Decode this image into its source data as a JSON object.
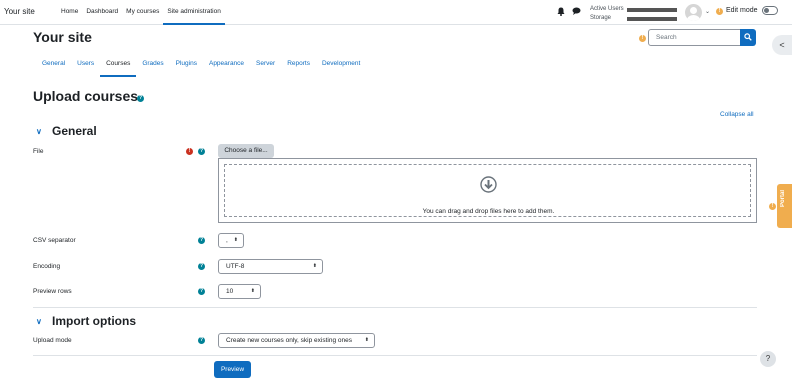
{
  "navbar": {
    "site_name": "Your site",
    "items": [
      "Home",
      "Dashboard",
      "My courses",
      "Site administration"
    ],
    "active_users_label": "Active Users",
    "storage_label": "Storage",
    "edit_mode_label": "Edit mode",
    "warning_glyph": "!"
  },
  "header": {
    "title": "Your site",
    "search_placeholder": "Search"
  },
  "secondary_nav": [
    "General",
    "Users",
    "Courses",
    "Grades",
    "Plugins",
    "Appearance",
    "Server",
    "Reports",
    "Development"
  ],
  "page": {
    "heading": "Upload courses",
    "collapse_all": "Collapse all",
    "help_glyph": "?",
    "required_glyph": "!"
  },
  "general_section": {
    "title": "General",
    "file_label": "File",
    "choose_file_button": "Choose a file...",
    "dropzone_text": "You can drag and drop files here to add them.",
    "csv_separator_label": "CSV separator",
    "csv_separator_value": ",",
    "encoding_label": "Encoding",
    "encoding_value": "UTF-8",
    "preview_rows_label": "Preview rows",
    "preview_rows_value": "10"
  },
  "import_section": {
    "title": "Import options",
    "upload_mode_label": "Upload mode",
    "upload_mode_value": "Create new courses only, skip existing ones"
  },
  "actions": {
    "preview_button": "Preview"
  },
  "floating": {
    "help_button": "?",
    "drawer_toggle": "<",
    "portal_tab": "Portal"
  },
  "colors": {
    "primary": "#0f6cbf",
    "help": "#008196",
    "required": "#ca3120",
    "warning": "#f0ad4e"
  }
}
